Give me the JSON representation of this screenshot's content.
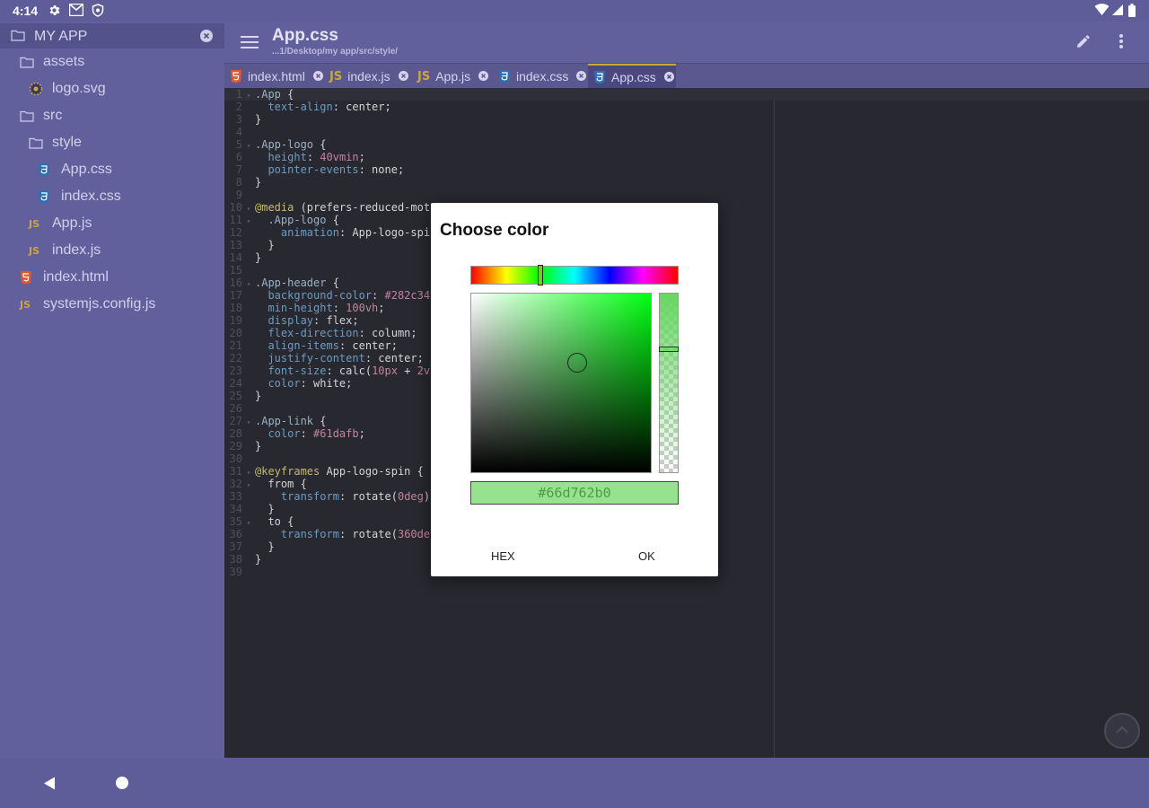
{
  "status_bar": {
    "time": "4:14"
  },
  "sidebar": {
    "project_title": "MY APP",
    "items": [
      {
        "label": "assets",
        "type": "folder"
      },
      {
        "label": "logo.svg",
        "type": "image"
      },
      {
        "label": "src",
        "type": "folder"
      },
      {
        "label": "style",
        "type": "folder"
      },
      {
        "label": "App.css",
        "type": "css"
      },
      {
        "label": "index.css",
        "type": "css"
      },
      {
        "label": "App.js",
        "type": "js"
      },
      {
        "label": "index.js",
        "type": "js"
      },
      {
        "label": "index.html",
        "type": "html"
      },
      {
        "label": "systemjs.config.js",
        "type": "js"
      }
    ]
  },
  "appbar": {
    "title": "App.css",
    "path": "...1/Desktop/my app/src/style/"
  },
  "tabs": [
    {
      "label": "index.html",
      "type": "html"
    },
    {
      "label": "index.js",
      "type": "js"
    },
    {
      "label": "App.js",
      "type": "js"
    },
    {
      "label": "index.css",
      "type": "css"
    },
    {
      "label": "App.css",
      "type": "css",
      "active": true
    }
  ],
  "editor": {
    "lines": [
      ".App {",
      "  text-align: center;",
      "}",
      "",
      ".App-logo {",
      "  height: 40vmin;",
      "  pointer-events: none;",
      "}",
      "",
      "@media (prefers-reduced-mot",
      "  .App-logo {",
      "    animation: App-logo-spi",
      "  }",
      "}",
      "",
      ".App-header {",
      "  background-color: #282c34",
      "  min-height: 100vh;",
      "  display: flex;",
      "  flex-direction: column;",
      "  align-items: center;",
      "  justify-content: center;",
      "  font-size: calc(10px + 2v",
      "  color: white;",
      "}",
      "",
      ".App-link {",
      "  color: #61dafb;",
      "}",
      "",
      "@keyframes App-logo-spin {",
      "  from {",
      "    transform: rotate(0deg)",
      "  }",
      "  to {",
      "    transform: rotate(360de",
      "  }",
      "}",
      ""
    ],
    "fold_lines": [
      1,
      5,
      10,
      11,
      16,
      27,
      31,
      32,
      35
    ]
  },
  "color_dialog": {
    "title": "Choose color",
    "hex_value": "#66d762b0",
    "hex_button": "HEX",
    "ok_button": "OK",
    "selected_color": "#66d762",
    "alpha": 0.69
  },
  "colors": {
    "background": "#5f5d99",
    "editor_bg": "#272830",
    "accent": "#c9a640"
  }
}
